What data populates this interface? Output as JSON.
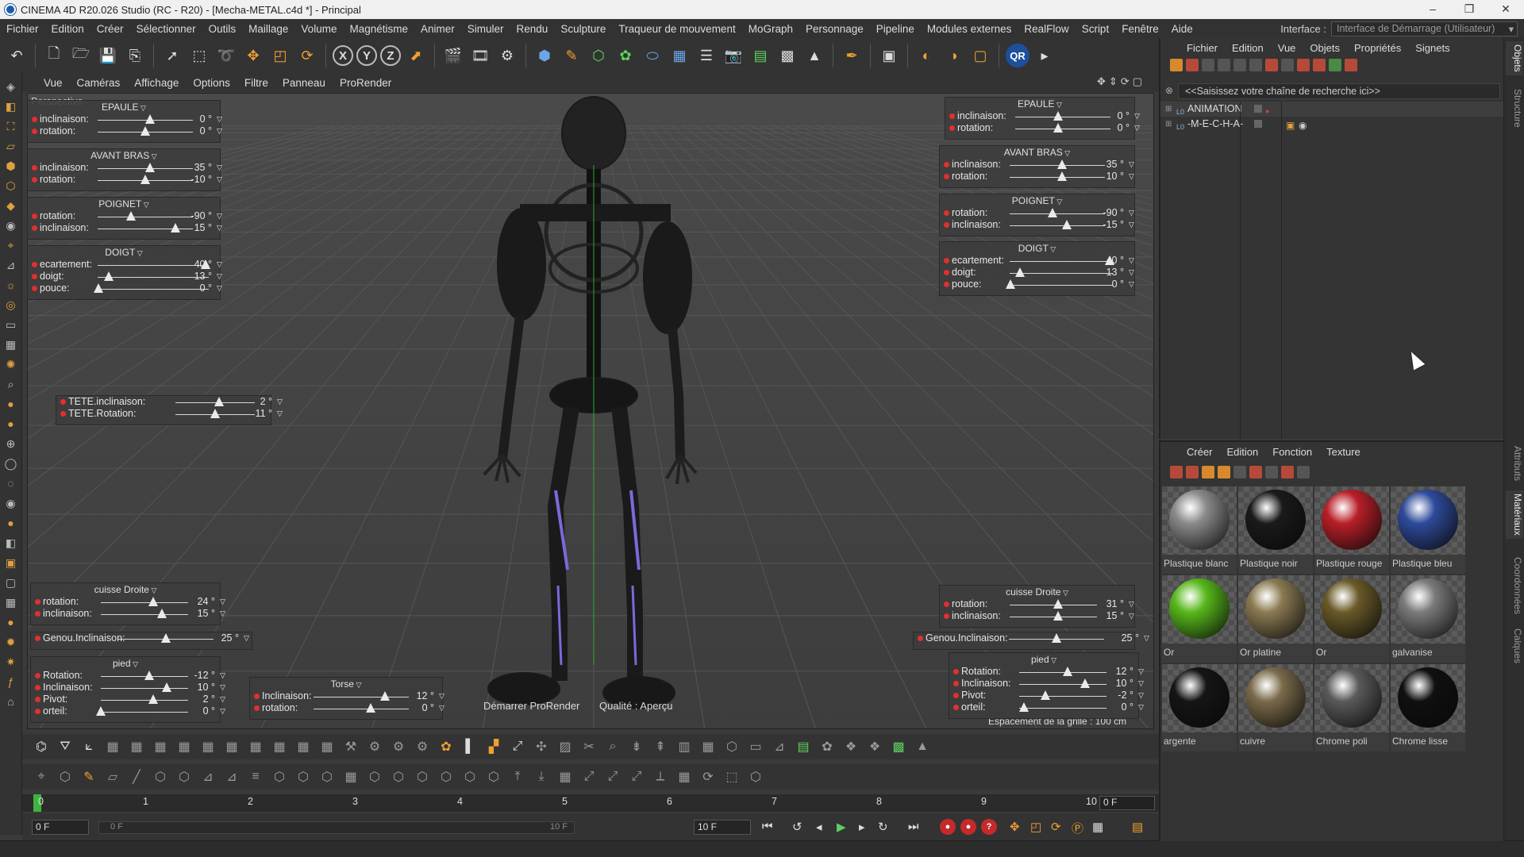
{
  "window": {
    "title": "CINEMA 4D R20.026 Studio (RC - R20) - [Mecha-METAL.c4d *] - Principal",
    "controls": [
      "–",
      "❐",
      "✕"
    ]
  },
  "menubar": [
    "Fichier",
    "Edition",
    "Créer",
    "Sélectionner",
    "Outils",
    "Maillage",
    "Volume",
    "Magnétisme",
    "Animer",
    "Simuler",
    "Rendu",
    "Sculpture",
    "Traqueur de mouvement",
    "MoGraph",
    "Personnage",
    "Pipeline",
    "Modules externes",
    "RealFlow",
    "Script",
    "Fenêtre",
    "Aide"
  ],
  "interface": {
    "label": "Interface :",
    "value": "Interface de Démarrage (Utilisateur)"
  },
  "toolbar_axes": [
    "X",
    "Y",
    "Z"
  ],
  "viewport": {
    "menu": [
      "Vue",
      "Caméras",
      "Affichage",
      "Options",
      "Filtre",
      "Panneau",
      "ProRender"
    ],
    "camera_label": "Perspective",
    "start_prorender": "Démarrer ProRender",
    "quality": "Qualité : Aperçu",
    "grid_spacing": "Espacement de la grille : 100 cm"
  },
  "hud": {
    "left": {
      "epaule": {
        "title": "EPAULE",
        "rows": [
          {
            "label": "inclinaison:",
            "value": "0 °"
          },
          {
            "label": "rotation:",
            "value": "0 °"
          }
        ]
      },
      "avant_bras": {
        "title": "AVANT BRAS",
        "rows": [
          {
            "label": "inclinaison:",
            "value": "35 °"
          },
          {
            "label": "rotation:",
            "value": "-10 °"
          }
        ]
      },
      "poignet": {
        "title": "POIGNET",
        "rows": [
          {
            "label": "rotation:",
            "value": "-90 °"
          },
          {
            "label": "inclinaison:",
            "value": "15 °"
          }
        ]
      },
      "doigt": {
        "title": "DOIGT",
        "rows": [
          {
            "label": "ecartement:",
            "value": "40 °"
          },
          {
            "label": "doigt:",
            "value": "13 °"
          },
          {
            "label": "pouce:",
            "value": "0 °"
          }
        ]
      },
      "tete": {
        "rows": [
          {
            "label": "TETE.inclinaison:",
            "value": "2 °"
          },
          {
            "label": "TETE.Rotation:",
            "value": "11 °"
          }
        ]
      },
      "cuisse": {
        "title": "cuisse Droite",
        "rows": [
          {
            "label": "rotation:",
            "value": "24 °"
          },
          {
            "label": "inclinaison:",
            "value": "15 °"
          }
        ]
      },
      "genou": {
        "label": "Genou.Inclinaison:",
        "value": "25 °"
      },
      "pied": {
        "title": "pied",
        "rows": [
          {
            "label": "Rotation:",
            "value": "-12 °"
          },
          {
            "label": "Inclinaison:",
            "value": "10 °"
          },
          {
            "label": "Pivot:",
            "value": "2 °"
          },
          {
            "label": "orteil:",
            "value": "0 °"
          }
        ]
      },
      "torse": {
        "title": "Torse",
        "rows": [
          {
            "label": "Inclinaison:",
            "value": "12 °"
          },
          {
            "label": "rotation:",
            "value": "0 °"
          }
        ]
      }
    },
    "right": {
      "epaule": {
        "title": "EPAULE",
        "rows": [
          {
            "label": "inclinaison:",
            "value": "0 °"
          },
          {
            "label": "rotation:",
            "value": "0 °"
          }
        ]
      },
      "avant_bras": {
        "title": "AVANT BRAS",
        "rows": [
          {
            "label": "inclinaison:",
            "value": "35 °"
          },
          {
            "label": "rotation:",
            "value": "10 °"
          }
        ]
      },
      "poignet": {
        "title": "POIGNET",
        "rows": [
          {
            "label": "rotation:",
            "value": "-90 °"
          },
          {
            "label": "inclinaison:",
            "value": "-15 °"
          }
        ]
      },
      "doigt": {
        "title": "DOIGT",
        "rows": [
          {
            "label": "ecartement:",
            "value": "40 °"
          },
          {
            "label": "doigt:",
            "value": "13 °"
          },
          {
            "label": "pouce:",
            "value": "0 °"
          }
        ]
      },
      "cuisse": {
        "title": "cuisse Droite",
        "rows": [
          {
            "label": "rotation:",
            "value": "31 °"
          },
          {
            "label": "inclinaison:",
            "value": "15 °"
          }
        ]
      },
      "genou": {
        "label": "Genou.Inclinaison:",
        "value": "25 °"
      },
      "pied": {
        "title": "pied",
        "rows": [
          {
            "label": "Rotation:",
            "value": "12 °"
          },
          {
            "label": "Inclinaison:",
            "value": "10 °"
          },
          {
            "label": "Pivot:",
            "value": "-2 °"
          },
          {
            "label": "orteil:",
            "value": "0 °"
          }
        ]
      }
    }
  },
  "timeline": {
    "ticks": [
      "0",
      "1",
      "2",
      "3",
      "4",
      "5",
      "6",
      "7",
      "8",
      "9",
      "10"
    ],
    "current_frame": "0 F",
    "start": "0 F",
    "range_start": "0 F",
    "range_end": "10 F",
    "end": "10 F"
  },
  "objects": {
    "menu": [
      "Fichier",
      "Edition",
      "Vue",
      "Objets",
      "Propriétés",
      "Signets"
    ],
    "search_placeholder": "<<Saisissez votre chaîne de recherche ici>>",
    "items": [
      {
        "name": "ANIMATION"
      },
      {
        "name": "-M-E-C-H-A-"
      }
    ]
  },
  "materials": {
    "menu": [
      "Créer",
      "Edition",
      "Fonction",
      "Texture"
    ],
    "items": [
      {
        "name": "Plastique blanc",
        "color": "#8a8a8a"
      },
      {
        "name": "Plastique noir",
        "color": "#1a1a1a"
      },
      {
        "name": "Plastique rouge",
        "color": "#b81f28"
      },
      {
        "name": "Plastique bleu",
        "color": "#2e4a9a"
      },
      {
        "name": "Or",
        "color": "#57b81a"
      },
      {
        "name": "Or platine",
        "color": "#8a7a52"
      },
      {
        "name": "Or",
        "color": "#6a5a28"
      },
      {
        "name": "galvanise",
        "color": "#7a7a7a"
      },
      {
        "name": "argente",
        "color": "#151515"
      },
      {
        "name": "cuivre",
        "color": "#7a6a4a"
      },
      {
        "name": "Chrome poli",
        "color": "#5a5a5a"
      },
      {
        "name": "Chrome lisse",
        "color": "#101010"
      }
    ]
  },
  "side_tabs": [
    "Objets",
    "Structure",
    "Attributs",
    "Matériaux",
    "Coordonnées",
    "Calques"
  ]
}
